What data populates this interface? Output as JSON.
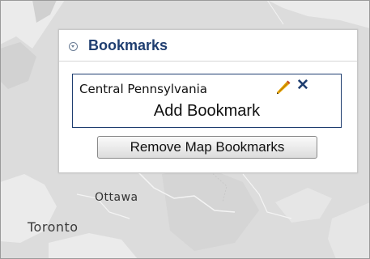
{
  "colors": {
    "map_land": "#dcdcdc",
    "map_water": "#ececec",
    "accent": "#1f3e70"
  },
  "map": {
    "labels": {
      "ottawa": "Ottawa",
      "toronto": "Toronto"
    }
  },
  "bookmarks_panel": {
    "title": "Bookmarks",
    "collapse_icon": "collapse-chevron-icon",
    "items": [
      {
        "name": "Central Pennsylvania",
        "edit_icon": "pencil-icon",
        "delete_icon": "close-icon"
      }
    ],
    "add_label": "Add Bookmark",
    "remove_button_label": "Remove Map Bookmarks"
  }
}
